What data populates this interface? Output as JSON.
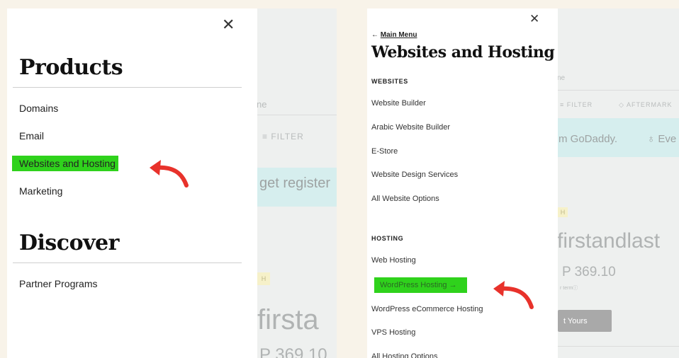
{
  "left_panel": {
    "close_glyph": "✕",
    "section_products": "Products",
    "products_items": [
      "Domains",
      "Email",
      "Websites and Hosting",
      "Marketing"
    ],
    "section_discover": "Discover",
    "discover_items": [
      "Partner Programs"
    ],
    "highlighted_item": "Websites and Hosting",
    "background": {
      "text_ne": "ne",
      "filter": "FILTER",
      "band_text": "get register",
      "badge": "H",
      "domain_partial": "firsta",
      "price_partial": "P 369.10"
    }
  },
  "right_panel": {
    "close_glyph": "✕",
    "back_arrow": "←",
    "back_label": "Main Menu",
    "title": "Websites and Hosting",
    "websites_label": "WEBSITES",
    "websites_items": [
      "Website Builder",
      "Arabic Website Builder",
      "E-Store",
      "Website Design Services",
      "All Website Options"
    ],
    "hosting_label": "HOSTING",
    "hosting_items": [
      "Web Hosting",
      "WordPress Hosting →",
      "WordPress eCommerce Hosting",
      "VPS Hosting",
      "All Hosting Options"
    ],
    "highlighted_item": "WordPress Hosting →",
    "background": {
      "text_ne": "ne",
      "filter": "FILTER",
      "aftermarket": "AFTERMARK",
      "band_text_1": "m GoDaddy.",
      "band_text_2": "Eve",
      "badge": "H",
      "domain_partial": "firstandlast",
      "price": "P 369.10",
      "term": "r term",
      "button": "t Yours"
    }
  },
  "colors": {
    "highlight": "#2fd21c",
    "arrow": "#e8322b",
    "band": "#d6eeee",
    "page_bg": "#f8f3e9"
  }
}
